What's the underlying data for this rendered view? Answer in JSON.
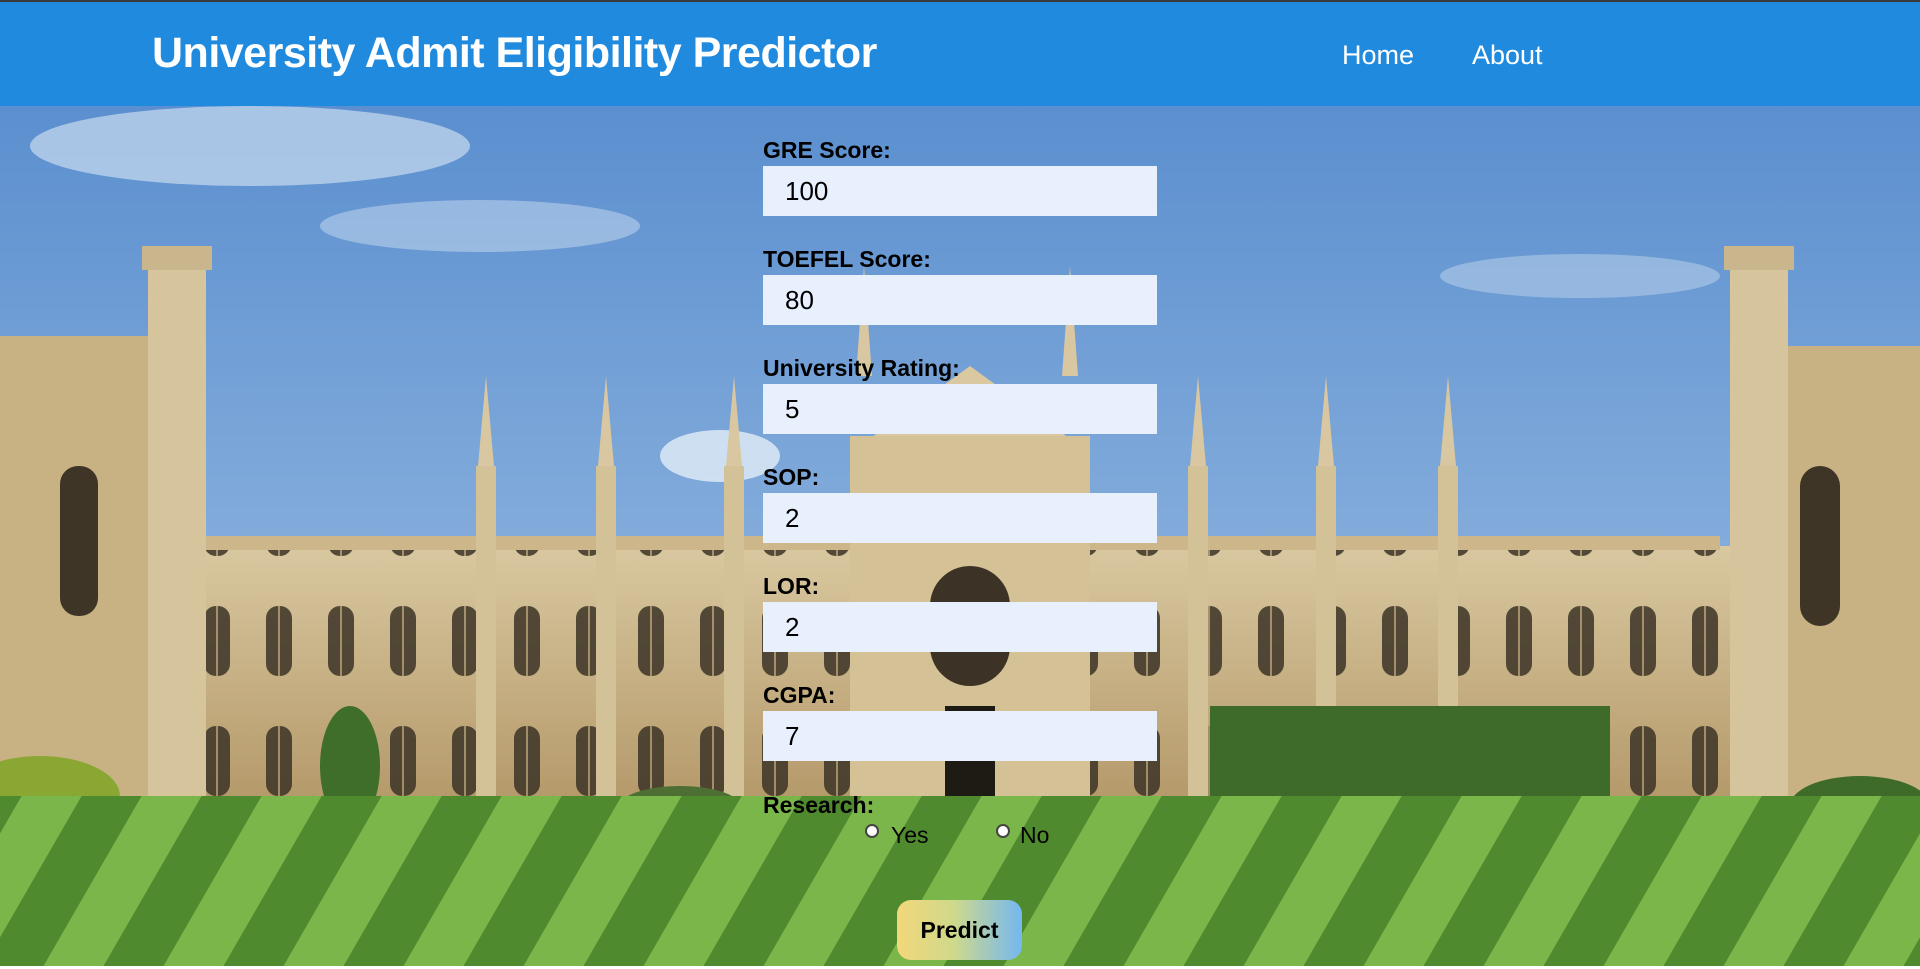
{
  "navbar": {
    "title": "University Admit Eligibility Predictor",
    "links": [
      "Home",
      "About"
    ]
  },
  "form": {
    "gre": {
      "label": "GRE Score:",
      "value": "100"
    },
    "toefl": {
      "label": "TOEFEL Score:",
      "value": "80"
    },
    "rating": {
      "label": "University Rating:",
      "value": "5"
    },
    "sop": {
      "label": "SOP:",
      "value": "2"
    },
    "lor": {
      "label": "LOR:",
      "value": "2"
    },
    "cgpa": {
      "label": "CGPA:",
      "value": "7"
    },
    "research": {
      "label": "Research:",
      "options": [
        "Yes",
        "No"
      ],
      "selected": "No"
    },
    "submit_label": "Predict"
  },
  "colors": {
    "navbar": "#1f8ade",
    "input_bg": "#e8f0fe"
  }
}
